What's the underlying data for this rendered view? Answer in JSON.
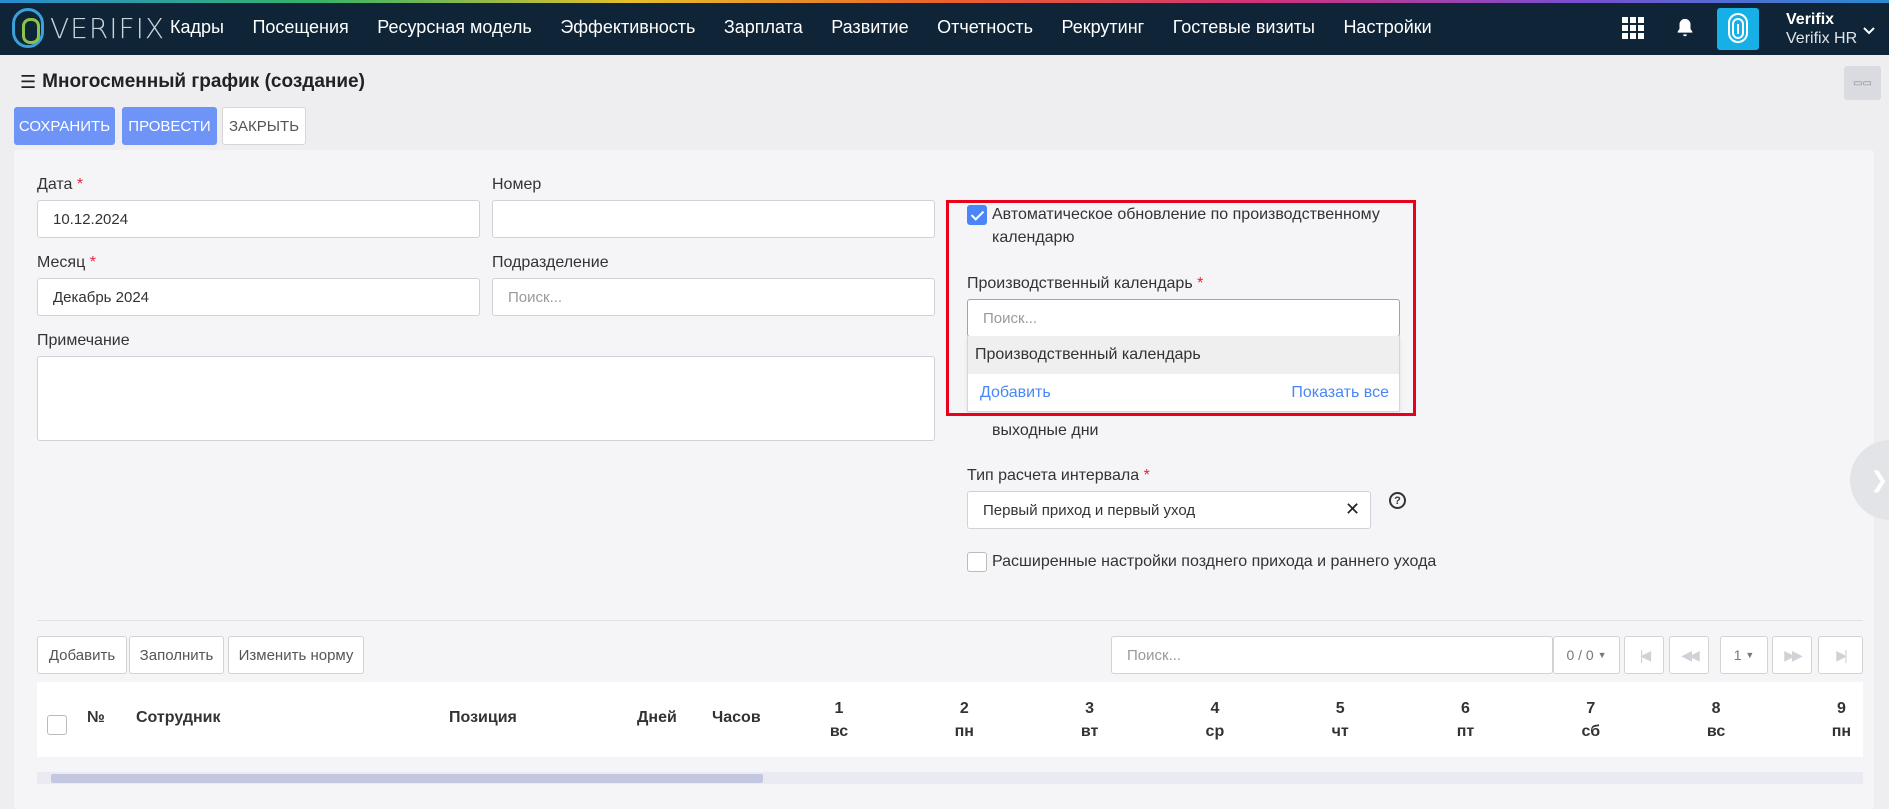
{
  "app": {
    "logo_text": "VERIFIX"
  },
  "nav": [
    "Кадры",
    "Посещения",
    "Ресурсная модель",
    "Эффективность",
    "Зарплата",
    "Развитие",
    "Отчетность",
    "Рекрутинг",
    "Гостевые визиты",
    "Настройки"
  ],
  "user": {
    "name": "Verifix",
    "org": "Verifix HR"
  },
  "page": {
    "title": "Многосменный график (создание)"
  },
  "toolbar": {
    "save": "СОХРАНИТЬ",
    "post": "ПРОВЕСТИ",
    "close": "ЗАКРЫТЬ"
  },
  "form": {
    "date_label": "Дата",
    "date_value": "10.12.2024",
    "number_label": "Номер",
    "number_value": "",
    "month_label": "Месяц",
    "month_value": "Декабрь 2024",
    "division_label": "Подразделение",
    "division_placeholder": "Поиск...",
    "note_label": "Примечание",
    "required_mark": "*",
    "auto_update_label": "Автоматическое обновление по производственному календарю",
    "auto_update_checked": true,
    "calendar_label": "Производственный календарь",
    "calendar_placeholder": "Поиск...",
    "calendar_dropdown": {
      "option": "Производственный календарь",
      "add": "Добавить",
      "show_all": "Показать все"
    },
    "hidden_checkbox_text": "выходные дни",
    "interval_label": "Тип расчета интервала",
    "interval_value": "Первый приход и первый уход",
    "advanced_label": "Расширенные настройки позднего прихода и раннего ухода",
    "advanced_checked": false
  },
  "table_toolbar": {
    "add": "Добавить",
    "fill": "Заполнить",
    "change_norm": "Изменить норму",
    "search_placeholder": "Поиск...",
    "count": "0 / 0",
    "page": "1"
  },
  "table": {
    "headers": {
      "num": "№",
      "employee": "Сотрудник",
      "position": "Позиция",
      "days": "Дней",
      "hours": "Часов"
    },
    "days": [
      {
        "d": "1",
        "w": "вс"
      },
      {
        "d": "2",
        "w": "пн"
      },
      {
        "d": "3",
        "w": "вт"
      },
      {
        "d": "4",
        "w": "ср"
      },
      {
        "d": "5",
        "w": "чт"
      },
      {
        "d": "6",
        "w": "пт"
      },
      {
        "d": "7",
        "w": "сб"
      },
      {
        "d": "8",
        "w": "вс"
      },
      {
        "d": "9",
        "w": "пн"
      }
    ]
  }
}
